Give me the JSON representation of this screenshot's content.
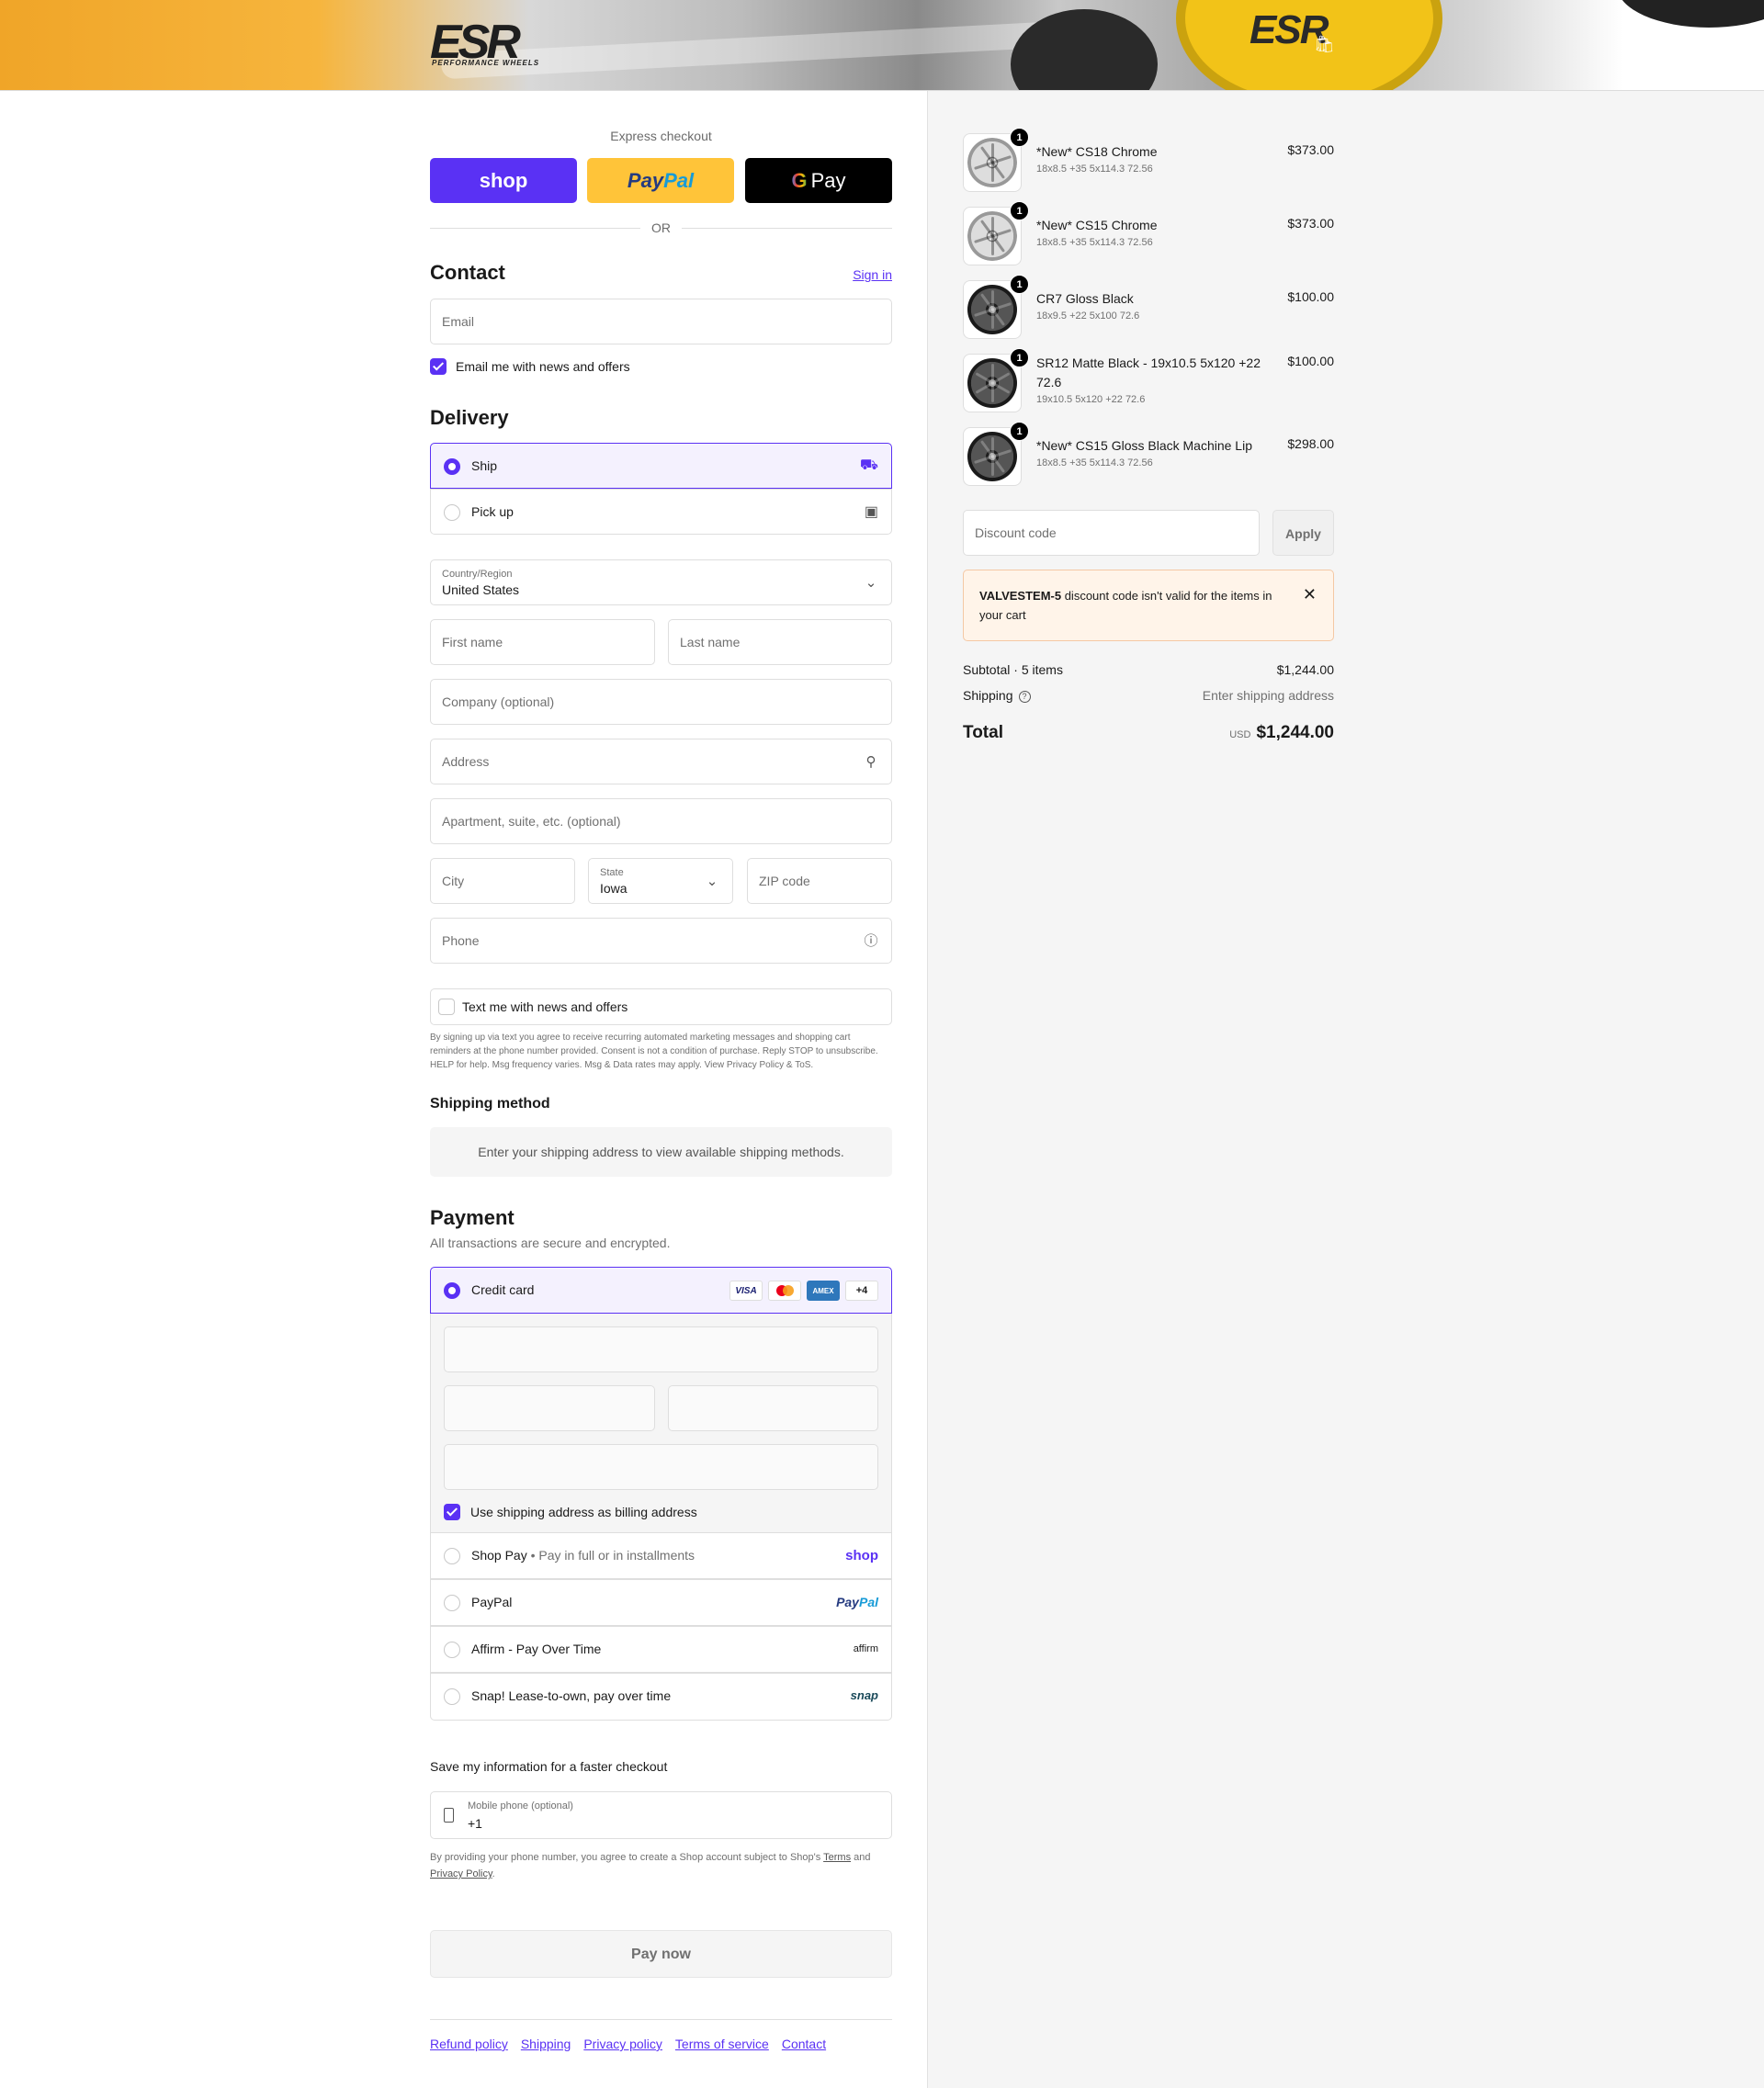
{
  "brand": {
    "logo_text": "ESR",
    "logo_sub": "PERFORMANCE WHEELS",
    "hub_text": "ESR",
    "accent": "#5a31f4"
  },
  "express": {
    "label": "Express checkout",
    "shop": "shop",
    "paypal_1": "Pay",
    "paypal_2": "Pal",
    "gpay_g": "G",
    "gpay_text": "Pay",
    "or": "OR"
  },
  "contact": {
    "title": "Contact",
    "sign_in": "Sign in",
    "email_placeholder": "Email",
    "news_label": "Email me with news and offers"
  },
  "delivery": {
    "title": "Delivery",
    "ship": "Ship",
    "pickup": "Pick up",
    "country_label": "Country/Region",
    "country_value": "United States",
    "first_name": "First name",
    "last_name": "Last name",
    "company": "Company (optional)",
    "address": "Address",
    "apartment": "Apartment, suite, etc. (optional)",
    "city": "City",
    "state_label": "State",
    "state_value": "Iowa",
    "zip": "ZIP code",
    "phone": "Phone",
    "text_label": "Text me with news and offers",
    "sms_note": "By signing up via text you agree to receive recurring automated marketing messages and shopping cart reminders at the phone number provided. Consent is not a condition of purchase. Reply STOP to unsubscribe. HELP for help. Msg frequency varies. Msg & Data rates may apply. View Privacy Policy & ToS."
  },
  "shipping_method": {
    "title": "Shipping method",
    "info": "Enter your shipping address to view available shipping methods."
  },
  "payment": {
    "title": "Payment",
    "subtitle": "All transactions are secure and encrypted.",
    "credit_card": "Credit card",
    "card_logos": {
      "visa": "VISA",
      "amex": "AMEX",
      "more": "+4"
    },
    "billing_label": "Use shipping address as billing address",
    "methods": [
      {
        "label": "Shop Pay",
        "sub": "Pay in full or in installments",
        "brand": "shop"
      },
      {
        "label": "PayPal",
        "brand_1": "Pay",
        "brand_2": "Pal"
      },
      {
        "label": "Affirm - Pay Over Time",
        "brand": "affirm"
      },
      {
        "label": "Snap! Lease-to-own, pay over time",
        "brand": "snap"
      }
    ]
  },
  "save_info": {
    "title": "Save my information for a faster checkout",
    "mobile_label": "Mobile phone (optional)",
    "mobile_value": "+1",
    "legal_1": "By providing your phone number, you agree to create a Shop account subject to Shop's",
    "terms": "Terms",
    "and": "and",
    "privacy": "Privacy Policy",
    "dot": "."
  },
  "pay_now": "Pay now",
  "footer": [
    "Refund policy",
    "Shipping",
    "Privacy policy",
    "Terms of service",
    "Contact"
  ],
  "cart": {
    "items": [
      {
        "qty": "1",
        "title": "*New* CS18 Chrome",
        "spec": "18x8.5 +35 5x114.3 72.56",
        "price": "$373.00",
        "finish": "chrome"
      },
      {
        "qty": "1",
        "title": "*New* CS15 Chrome",
        "spec": "18x8.5 +35 5x114.3 72.56",
        "price": "$373.00",
        "finish": "chrome"
      },
      {
        "qty": "1",
        "title": "CR7 Gloss Black",
        "spec": "18x9.5 +22 5x100 72.6",
        "price": "$100.00",
        "finish": "black"
      },
      {
        "qty": "1",
        "title": "SR12 Matte Black - 19x10.5 5x120 +22 72.6",
        "spec": "19x10.5 5x120 +22 72.6",
        "price": "$100.00",
        "finish": "black"
      },
      {
        "qty": "1",
        "title": "*New* CS15 Gloss Black Machine Lip",
        "spec": "18x8.5 +35 5x114.3 72.56",
        "price": "$298.00",
        "finish": "black"
      }
    ],
    "discount_placeholder": "Discount code",
    "apply": "Apply",
    "error_code": "VALVESTEM-5",
    "error_msg": " discount code isn't valid for the items in your cart",
    "subtotal_label": "Subtotal · 5 items",
    "subtotal_value": "$1,244.00",
    "shipping_label": "Shipping",
    "shipping_value": "Enter shipping address",
    "total_label": "Total",
    "currency": "USD",
    "total_value": "$1,244.00"
  }
}
